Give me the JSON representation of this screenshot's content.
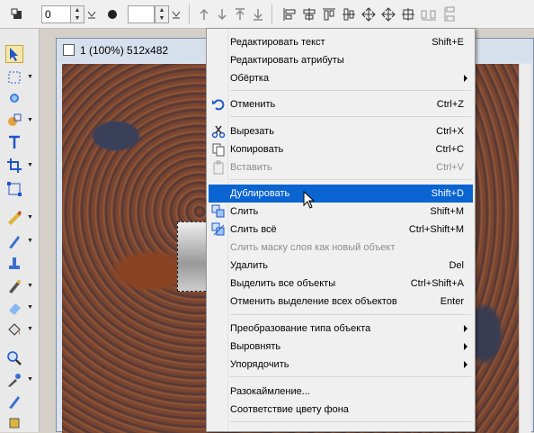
{
  "toolbar": {
    "spin1_value": "0",
    "spin2_value": ""
  },
  "tools": [
    "select-arrow-icon",
    "marquee-icon",
    "lasso-icon",
    "shape-icon",
    "text-icon",
    "crop-icon",
    "transform-icon",
    "paint-icon",
    "brush-icon",
    "stamp-icon",
    "eraser-icon",
    "fill-icon",
    "zoom-icon",
    "eyedropper-icon",
    "pen-icon",
    "hand-icon"
  ],
  "document": {
    "title": "1 (100%) 512x482"
  },
  "menu": {
    "items": [
      {
        "label": "Редактировать текст",
        "shortcut": "Shift+E",
        "disabled": false,
        "icon": ""
      },
      {
        "label": "Редактировать атрибуты",
        "shortcut": "",
        "disabled": false,
        "icon": ""
      },
      {
        "label": "Обёртка",
        "shortcut": "",
        "disabled": false,
        "submenu": true
      },
      {
        "label": "Отменить",
        "shortcut": "Ctrl+Z",
        "disabled": false,
        "icon": "undo-icon"
      },
      {
        "label": "Вырезать",
        "shortcut": "Ctrl+X",
        "disabled": false,
        "icon": "scissors-icon"
      },
      {
        "label": "Копировать",
        "shortcut": "Ctrl+C",
        "disabled": false,
        "icon": "copy-icon"
      },
      {
        "label": "Вставить",
        "shortcut": "Ctrl+V",
        "disabled": true,
        "icon": "paste-icon"
      },
      {
        "label": "Дублировать",
        "shortcut": "Shift+D",
        "disabled": false,
        "highlighted": true
      },
      {
        "label": "Слить",
        "shortcut": "Shift+M",
        "disabled": false,
        "icon": "merge-icon"
      },
      {
        "label": "Слить всё",
        "shortcut": "Ctrl+Shift+M",
        "disabled": false,
        "icon": "merge-all-icon"
      },
      {
        "label": "Слить маску слоя как новый объект",
        "shortcut": "",
        "disabled": true
      },
      {
        "label": "Удалить",
        "shortcut": "Del",
        "disabled": false
      },
      {
        "label": "Выделить все объекты",
        "shortcut": "Ctrl+Shift+A",
        "disabled": false
      },
      {
        "label": "Отменить выделение всех объектов",
        "shortcut": "Enter",
        "disabled": false
      },
      {
        "label": "Преобразование типа объекта",
        "shortcut": "",
        "disabled": false,
        "submenu": true
      },
      {
        "label": "Выровнять",
        "shortcut": "",
        "disabled": false,
        "submenu": true
      },
      {
        "label": "Упорядочить",
        "shortcut": "",
        "disabled": false,
        "submenu": true
      },
      {
        "label": "Разокаймление...",
        "shortcut": "",
        "disabled": false
      },
      {
        "label": "Соответствие цвету фона",
        "shortcut": "",
        "disabled": false
      }
    ]
  },
  "colors": {
    "highlight": "#0a64d2",
    "disabled": "#8d8d8d"
  }
}
